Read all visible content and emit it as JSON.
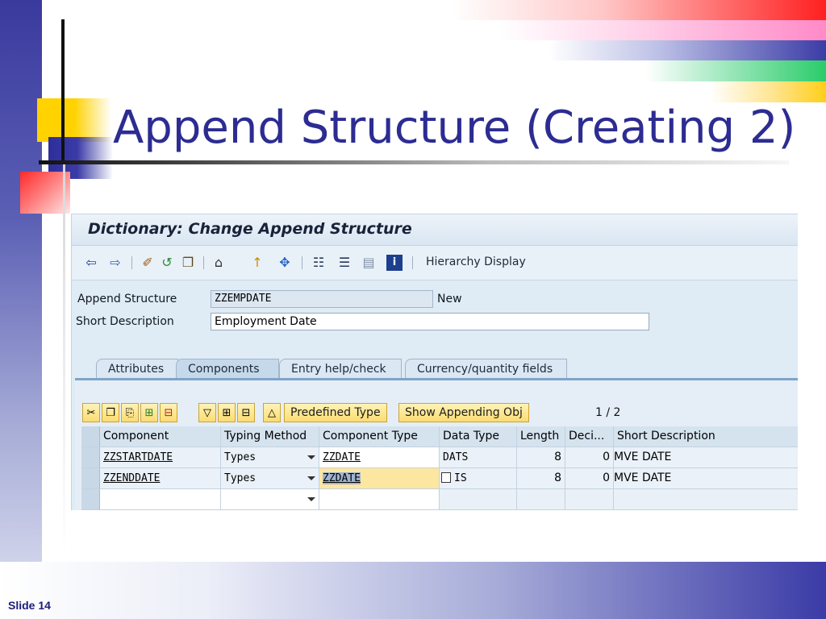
{
  "slide": {
    "title": "Append Structure (Creating 2)",
    "number": "Slide 14"
  },
  "sap": {
    "window_title": "Dictionary: Change Append Structure",
    "toolbar": {
      "icons": [
        "back-icon",
        "forward-icon",
        "other-object-icon",
        "display-change-icon",
        "activate-icon",
        "check-icon",
        "where-used-icon",
        "navigation-icon",
        "object-list-icon",
        "hierarchy-icon",
        "table-icon",
        "info-icon"
      ],
      "hierarchy_display": "Hierarchy Display"
    },
    "append_structure": {
      "label": "Append Structure",
      "value": "ZZEMPDATE",
      "status": "New"
    },
    "short_description": {
      "label": "Short Description",
      "value": "Employment Date"
    },
    "tabs": [
      "Attributes",
      "Components",
      "Entry help/check",
      "Currency/quantity fields"
    ],
    "active_tab": "Components",
    "table_toolbar": {
      "icon_buttons": [
        "cut-icon",
        "copy-icon",
        "paste-icon",
        "insert-row-icon",
        "delete-row-icon",
        "filter-icon",
        "first-page-icon",
        "previous-page-icon",
        "top-icon"
      ],
      "predefined_type": "Predefined Type",
      "show_appending_obj": "Show Appending Obj",
      "page_current": "1",
      "page_sep": "/",
      "page_total": "2"
    },
    "columns": [
      "Component",
      "Typing Method",
      "Component Type",
      "Data Type",
      "Length",
      "Deci...",
      "Short Description"
    ],
    "rows": [
      {
        "component": "ZZSTARTDATE",
        "typing_method": "Types",
        "component_type": "ZZDATE",
        "data_type": "DATS",
        "length": "8",
        "decimals": "0",
        "short_description": "MVE DATE"
      },
      {
        "component": "ZZENDDATE",
        "typing_method": "Types",
        "component_type": "ZZDATE",
        "data_type": "IS",
        "length": "8",
        "decimals": "0",
        "short_description": "MVE DATE"
      },
      {
        "component": "",
        "typing_method": "",
        "component_type": "",
        "data_type": "",
        "length": "",
        "decimals": "",
        "short_description": ""
      }
    ]
  }
}
